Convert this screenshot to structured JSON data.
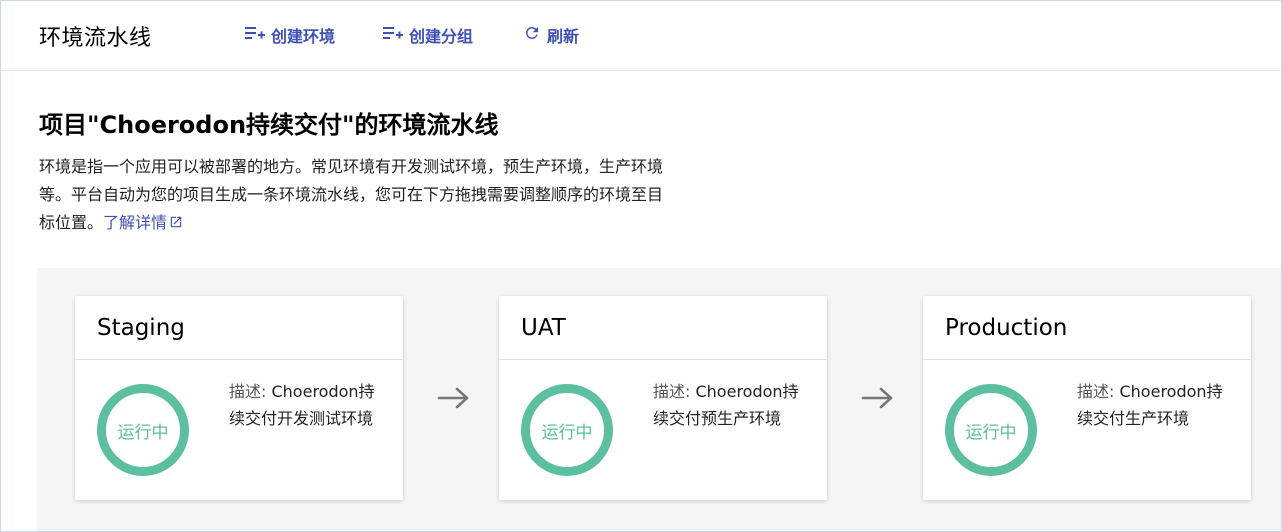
{
  "header": {
    "title": "环境流水线",
    "actions": [
      {
        "label": "创建环境",
        "icon": "playlist-add-icon"
      },
      {
        "label": "创建分组",
        "icon": "playlist-add-icon"
      },
      {
        "label": "刷新",
        "icon": "refresh-icon"
      }
    ]
  },
  "main": {
    "title": "项目\"Choerodon持续交付\"的环境流水线",
    "description_lines": [
      "环境是指一个应用可以被部署的地方。常见环境有开发测试环境，预生产环境，生产环境",
      "等。平台自动为您的项目生成一条环境流水线，您可在下方拖拽需要调整顺序的环境至目",
      "标位置。"
    ],
    "learn_more": "了解详情"
  },
  "environments": [
    {
      "name": "Staging",
      "status": "运行中",
      "desc_label": "描述:",
      "desc_value": " Choerodon持续交付开发测试环境"
    },
    {
      "name": "UAT",
      "status": "运行中",
      "desc_label": "描述:",
      "desc_value": " Choerodon持续交付预生产环境"
    },
    {
      "name": "Production",
      "status": "运行中",
      "desc_label": "描述:",
      "desc_value": " Choerodon持续交付生产环境"
    }
  ],
  "colors": {
    "accent": "#3f51b5",
    "status_running": "#5cbfa0",
    "board_bg": "#f5f5f5"
  }
}
